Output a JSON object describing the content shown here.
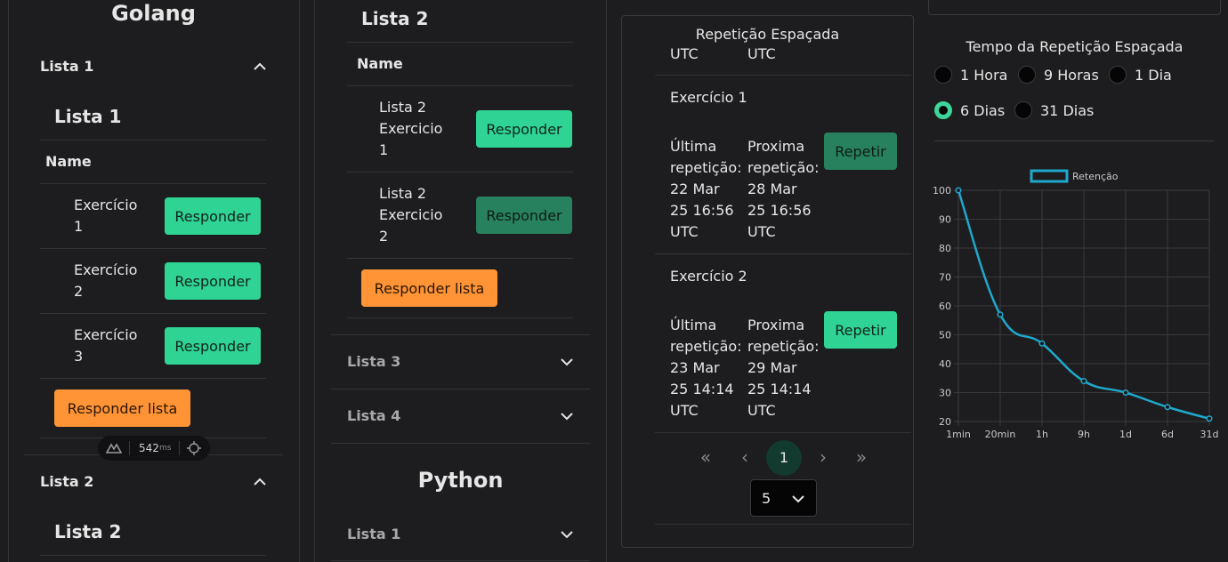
{
  "col1": {
    "heading": "Golang",
    "acc1_title": "Lista 1",
    "acc1_inner_title": "Lista 1",
    "table_header": "Name",
    "rows": [
      {
        "l1": "Exercício",
        "l2": "1",
        "btn": "Responder"
      },
      {
        "l1": "Exercício",
        "l2": "2",
        "btn": "Responder"
      },
      {
        "l1": "Exercício",
        "l2": "3",
        "btn": "Responder"
      }
    ],
    "respond_list": "Responder lista",
    "acc2_title": "Lista 2",
    "acc2_inner_title": "Lista 2",
    "devtool_ms": "542",
    "devtool_unit": "ms"
  },
  "col2": {
    "inner_title": "Lista 2",
    "table_header": "Name",
    "rows": [
      {
        "l1": "Lista 2",
        "l2": "Exercicio",
        "l3": "1",
        "btn": "Responder"
      },
      {
        "l1": "Lista 2",
        "l2": "Exercicio",
        "l3": "2",
        "btn": "Responder"
      }
    ],
    "respond_list": "Responder lista",
    "acc3": "Lista 3",
    "acc4": "Lista 4",
    "section2": "Python",
    "py_acc1": "Lista 1"
  },
  "col3": {
    "title": "Repetição Espaçada",
    "top_utc_a": "UTC",
    "top_utc_b": "UTC",
    "items": [
      {
        "name": "Exercício 1",
        "last": [
          "Última",
          "repetição:",
          "22 Mar",
          "25 16:56",
          "UTC"
        ],
        "next": [
          "Proxima",
          "repetição:",
          "28 Mar",
          "25 16:56",
          "UTC"
        ],
        "btn": "Repetir"
      },
      {
        "name": "Exercício 2",
        "last": [
          "Última",
          "repetição:",
          "23 Mar",
          "25 14:14",
          "UTC"
        ],
        "next": [
          "Proxima",
          "repetição:",
          "29 Mar",
          "25 14:14",
          "UTC"
        ],
        "btn": "Repetir"
      }
    ],
    "pager": {
      "first": "«",
      "prev": "‹",
      "current": "1",
      "next": "›",
      "last": "»"
    },
    "page_size": "5"
  },
  "col4": {
    "title": "Tempo da Repetição Espaçada",
    "options": [
      "1 Hora",
      "9 Horas",
      "1 Dia",
      "6 Dias",
      "31 Dias"
    ],
    "selected": "6 Dias"
  },
  "chart_data": {
    "type": "line",
    "categories": [
      "1min",
      "20min",
      "1h",
      "9h",
      "1d",
      "6d",
      "31d"
    ],
    "series": [
      {
        "name": "Retenção",
        "values": [
          100,
          57,
          47,
          34,
          30,
          25,
          21
        ]
      }
    ],
    "yticks": [
      "100",
      "90",
      "80",
      "70",
      "60",
      "50",
      "40",
      "30",
      "20"
    ],
    "ylim": [
      20,
      100
    ],
    "legend": "top-center",
    "color": "#1fa8cc",
    "grid": true
  }
}
